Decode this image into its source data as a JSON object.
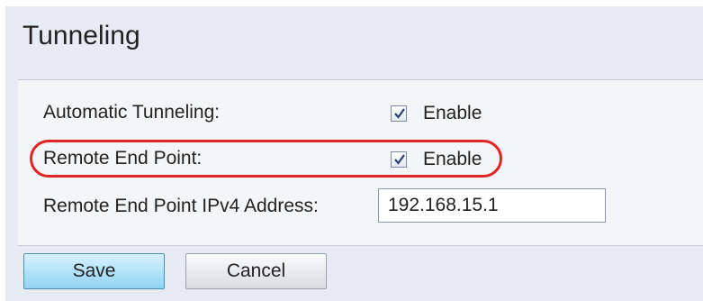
{
  "title": "Tunneling",
  "rows": {
    "automatic_tunneling": {
      "label": "Automatic Tunneling:",
      "checkbox_label": "Enable",
      "checked": true
    },
    "remote_end_point": {
      "label": "Remote End Point:",
      "checkbox_label": "Enable",
      "checked": true
    },
    "remote_ipv4": {
      "label": "Remote End Point IPv4 Address:",
      "value": "192.168.15.1"
    }
  },
  "buttons": {
    "save": "Save",
    "cancel": "Cancel"
  },
  "colors": {
    "highlight": "#e02424",
    "save_button": "#8fd3f2",
    "background": "#e7ecf4"
  },
  "icons": {
    "checkbox": "checkmark-icon"
  }
}
